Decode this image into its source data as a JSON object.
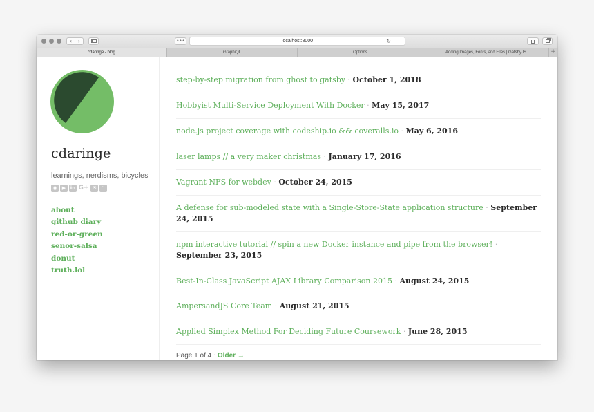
{
  "browser": {
    "url": "localhost:8000",
    "tabs": [
      {
        "label": "cdaringe - blog",
        "active": true
      },
      {
        "label": "GraphiQL",
        "active": false
      },
      {
        "label": "Options",
        "active": false
      },
      {
        "label": "Adding Images, Fonts, and Files | GatsbyJS",
        "active": false
      }
    ],
    "new_tab_label": "+",
    "reload_glyph": "↻",
    "dots_label": "•••",
    "back_glyph": "‹",
    "forward_glyph": "›"
  },
  "sidebar": {
    "title": "cdaringe",
    "tagline": "learnings, nerdisms, bicycles",
    "social_icons": [
      "github-icon",
      "youtube-icon",
      "linkedin-icon",
      "google-plus-icon",
      "email-icon",
      "rss-icon"
    ],
    "social_glyphs": {
      "github": "◉",
      "youtube": "▶",
      "linkedin": "in",
      "google_plus": "G+",
      "email": "✉",
      "rss": "◝"
    },
    "links": [
      "about",
      "github diary",
      "red-or-green",
      "senor-salsa",
      "donut",
      "truth.lol"
    ]
  },
  "posts": [
    {
      "title": "step-by-step migration from ghost to gatsby",
      "date": "October 1, 2018"
    },
    {
      "title": "Hobbyist Multi-Service Deployment With Docker",
      "date": "May 15, 2017"
    },
    {
      "title": "node.js project coverage with codeship.io && coveralls.io",
      "date": "May 6, 2016"
    },
    {
      "title": "laser lamps // a very maker christmas",
      "date": "January 17, 2016"
    },
    {
      "title": "Vagrant NFS for webdev",
      "date": "October 24, 2015"
    },
    {
      "title": "A defense for sub-modeled state with a Single-Store-State application structure",
      "date": "September 24, 2015"
    },
    {
      "title": "npm interactive tutorial // spin a new Docker instance and pipe from the browser!",
      "date": "September 23, 2015"
    },
    {
      "title": "Best-In-Class JavaScript AJAX Library Comparison 2015",
      "date": "August 24, 2015"
    },
    {
      "title": "AmpersandJS Core Team",
      "date": "August 21, 2015"
    },
    {
      "title": "Applied Simplex Method For Deciding Future Coursework",
      "date": "June 28, 2015"
    }
  ],
  "separator": "·",
  "pager": {
    "status": "Page 1 of 4",
    "older_label": "Older →"
  },
  "colors": {
    "accent": "#5fb05c",
    "logo_light": "#74bd67",
    "logo_dark": "#2b4a2f"
  }
}
